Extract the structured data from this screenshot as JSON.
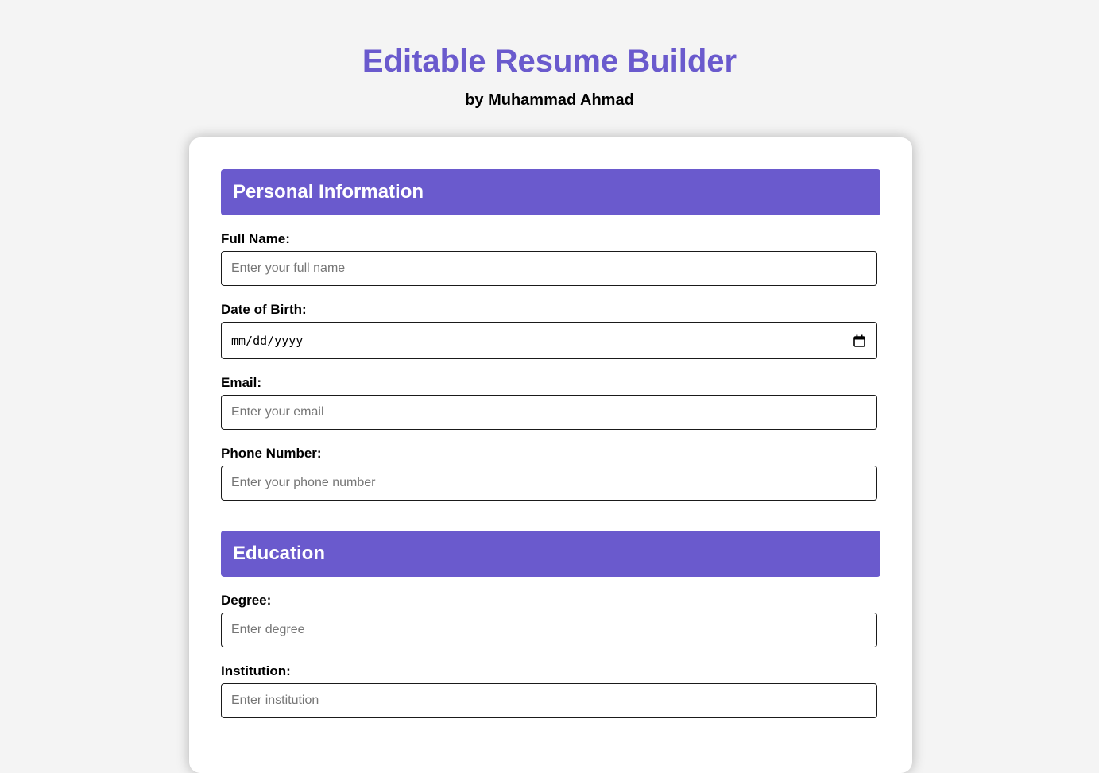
{
  "header": {
    "title": "Editable Resume Builder",
    "subtitle": "by Muhammad Ahmad"
  },
  "personal": {
    "heading": "Personal Information",
    "full_name_label": "Full Name:",
    "full_name_placeholder": "Enter your full name",
    "full_name_value": "",
    "dob_label": "Date of Birth:",
    "dob_placeholder": "mm/dd/yyyy",
    "dob_icon": "calendar-icon",
    "email_label": "Email:",
    "email_placeholder": "Enter your email",
    "email_value": "",
    "phone_label": "Phone Number:",
    "phone_placeholder": "Enter your phone number",
    "phone_value": ""
  },
  "education": {
    "heading": "Education",
    "degree_label": "Degree:",
    "degree_placeholder": "Enter degree",
    "degree_value": "",
    "institution_label": "Institution:",
    "institution_placeholder": "Enter institution",
    "institution_value": ""
  },
  "colors": {
    "accent": "#6a5acd",
    "background": "#f4f4f4",
    "card": "#ffffff"
  }
}
